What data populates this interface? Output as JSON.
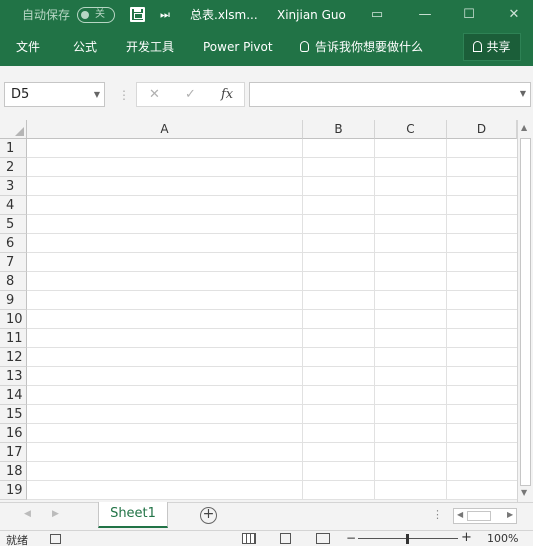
{
  "titlebar": {
    "autosave_label": "自动保存",
    "autosave_state": "关",
    "more_icon": "⏭",
    "filename": "总表.xlsm...",
    "username": "Xinjian Guo",
    "ribbon_display_icon": "▭",
    "minimize_icon": "—",
    "maximize_icon": "☐",
    "close_icon": "✕"
  },
  "ribbon": {
    "tabs": [
      "文件",
      "公式",
      "开发工具",
      "Power Pivot"
    ],
    "tell_me": "告诉我你想要做什么",
    "share": "共享"
  },
  "formula_bar": {
    "name_box": "D5",
    "cancel_icon": "✕",
    "enter_icon": "✓",
    "fx_icon": "fx",
    "formula": ""
  },
  "grid": {
    "columns": [
      "A",
      "B",
      "C",
      "D"
    ],
    "rows": [
      "1",
      "2",
      "3",
      "4",
      "5",
      "6",
      "7",
      "8",
      "9",
      "10",
      "11",
      "12",
      "13",
      "14",
      "15",
      "16",
      "17",
      "18",
      "19"
    ]
  },
  "sheets": {
    "tabs": [
      "Sheet1"
    ],
    "active": "Sheet1",
    "add_icon": "+"
  },
  "statusbar": {
    "status": "就绪",
    "zoom_minus": "−",
    "zoom_plus": "+",
    "zoom": "100%"
  },
  "colors": {
    "brand": "#217346",
    "grid_line": "#e1e1e1"
  }
}
